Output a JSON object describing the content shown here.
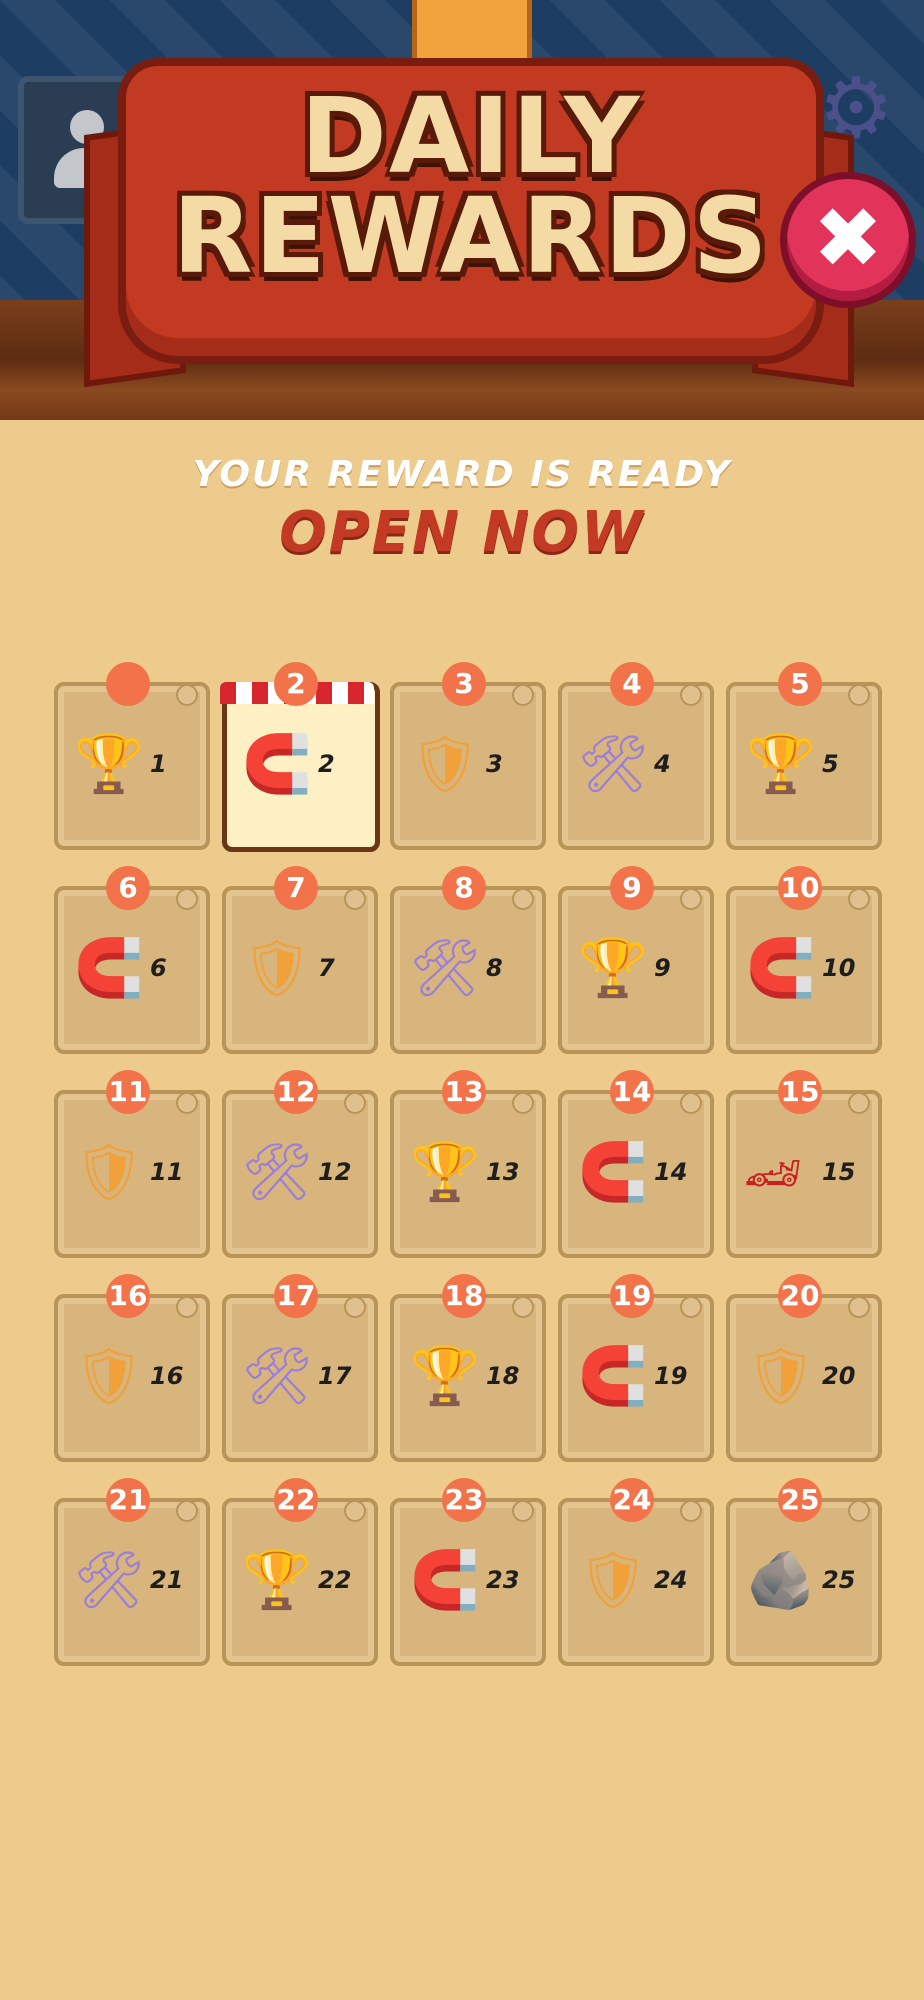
{
  "header": {
    "title_line1": "DAILY",
    "title_line2": "REWARDS",
    "close_glyph": "✖",
    "gear_glyph": "⚙"
  },
  "message": {
    "line1": "YOUR REWARD IS READY",
    "line2": "OPEN NOW"
  },
  "rewards": [
    {
      "day": "",
      "label": "1",
      "icon": "trophy-icon",
      "glyph": "🏆"
    },
    {
      "day": "2",
      "label": "2",
      "icon": "magnet-icon",
      "glyph": "🧲"
    },
    {
      "day": "3",
      "label": "3",
      "icon": "shield-icon",
      "glyph": "🛡"
    },
    {
      "day": "4",
      "label": "4",
      "icon": "tools-icon",
      "glyph": "🛠"
    },
    {
      "day": "5",
      "label": "5",
      "icon": "trophy-icon",
      "glyph": "🏆"
    },
    {
      "day": "6",
      "label": "6",
      "icon": "magnet-icon",
      "glyph": "🧲"
    },
    {
      "day": "7",
      "label": "7",
      "icon": "shield-icon",
      "glyph": "🛡"
    },
    {
      "day": "8",
      "label": "8",
      "icon": "tools-icon",
      "glyph": "🛠"
    },
    {
      "day": "9",
      "label": "9",
      "icon": "trophy-icon",
      "glyph": "🏆"
    },
    {
      "day": "10",
      "label": "10",
      "icon": "magnet-icon",
      "glyph": "🧲"
    },
    {
      "day": "11",
      "label": "11",
      "icon": "shield-icon",
      "glyph": "🛡"
    },
    {
      "day": "12",
      "label": "12",
      "icon": "tools-icon",
      "glyph": "🛠"
    },
    {
      "day": "13",
      "label": "13",
      "icon": "trophy-icon",
      "glyph": "🏆"
    },
    {
      "day": "14",
      "label": "14",
      "icon": "magnet-icon",
      "glyph": "🧲"
    },
    {
      "day": "15",
      "label": "15",
      "icon": "race-car-icon",
      "glyph": "🏎"
    },
    {
      "day": "16",
      "label": "16",
      "icon": "shield-icon",
      "glyph": "🛡"
    },
    {
      "day": "17",
      "label": "17",
      "icon": "tools-icon",
      "glyph": "🛠"
    },
    {
      "day": "18",
      "label": "18",
      "icon": "trophy-icon",
      "glyph": "🏆"
    },
    {
      "day": "19",
      "label": "19",
      "icon": "magnet-icon",
      "glyph": "🧲"
    },
    {
      "day": "20",
      "label": "20",
      "icon": "shield-icon",
      "glyph": "🛡"
    },
    {
      "day": "21",
      "label": "21",
      "icon": "tools-icon",
      "glyph": "🛠"
    },
    {
      "day": "22",
      "label": "22",
      "icon": "trophy-icon",
      "glyph": "🏆"
    },
    {
      "day": "23",
      "label": "23",
      "icon": "magnet-icon",
      "glyph": "🧲"
    },
    {
      "day": "24",
      "label": "24",
      "icon": "shield-icon",
      "glyph": "🛡"
    },
    {
      "day": "25",
      "label": "25",
      "icon": "treasure-crate-icon",
      "glyph": "🪨"
    }
  ],
  "today_index": 1
}
